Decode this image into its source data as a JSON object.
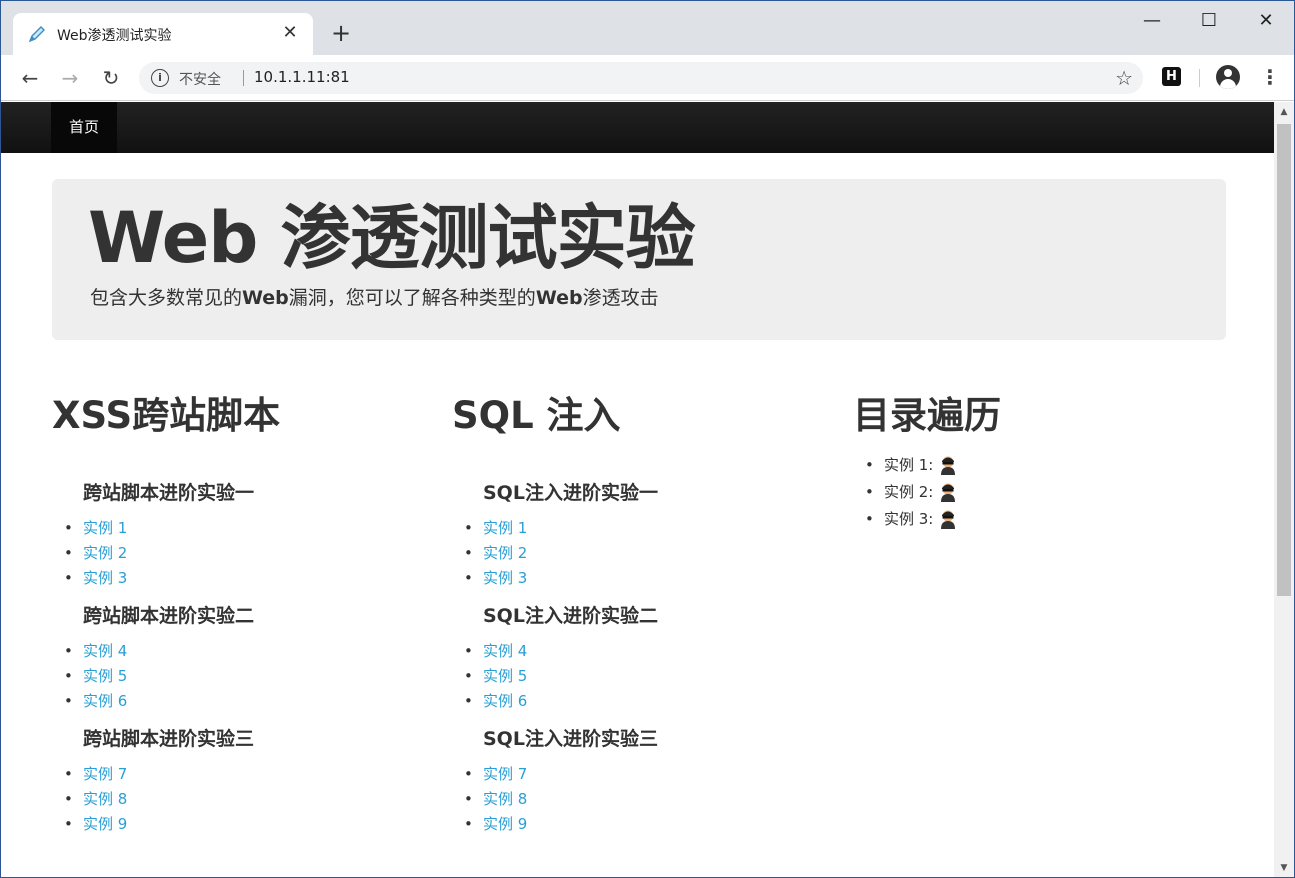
{
  "browser": {
    "tab_title": "Web渗透测试实验",
    "new_tab_label": "+",
    "close_tab_label": "✕",
    "security_label": "不安全",
    "url": "10.1.1.11:81",
    "extension_label": "H"
  },
  "window_controls": {
    "minimize": "—",
    "maximize": "☐",
    "close": "✕"
  },
  "navbar": {
    "home": "首页"
  },
  "jumbotron": {
    "title": "Web 渗透测试实验",
    "subtitle_parts": [
      "包含大多数常见的",
      "Web",
      "漏洞，您可以了解各种类型的",
      "Web",
      "渗透攻击"
    ]
  },
  "xss": {
    "heading": "XSS跨站脚本",
    "groups": [
      {
        "title": "跨站脚本进阶实验一",
        "items": [
          "实例 1",
          "实例 2",
          "实例 3"
        ]
      },
      {
        "title": "跨站脚本进阶实验二",
        "items": [
          "实例 4",
          "实例 5",
          "实例 6"
        ]
      },
      {
        "title": "跨站脚本进阶实验三",
        "items": [
          "实例 7",
          "实例 8",
          "实例 9"
        ]
      }
    ]
  },
  "sql": {
    "heading": "SQL 注入",
    "groups": [
      {
        "title": "SQL注入进阶实验一",
        "items": [
          "实例 1",
          "实例 2",
          "实例 3"
        ]
      },
      {
        "title": "SQL注入进阶实验二",
        "items": [
          "实例 4",
          "实例 5",
          "实例 6"
        ]
      },
      {
        "title": "SQL注入进阶实验三",
        "items": [
          "实例 7",
          "实例 8",
          "实例 9"
        ]
      }
    ]
  },
  "dir": {
    "heading": "目录遍历",
    "items": [
      "实例 1:",
      "实例 2:",
      "实例 3:"
    ]
  },
  "colors": {
    "link": "#2a9fd6",
    "navbar": "#111111",
    "jumbotron": "#eeeeee"
  }
}
